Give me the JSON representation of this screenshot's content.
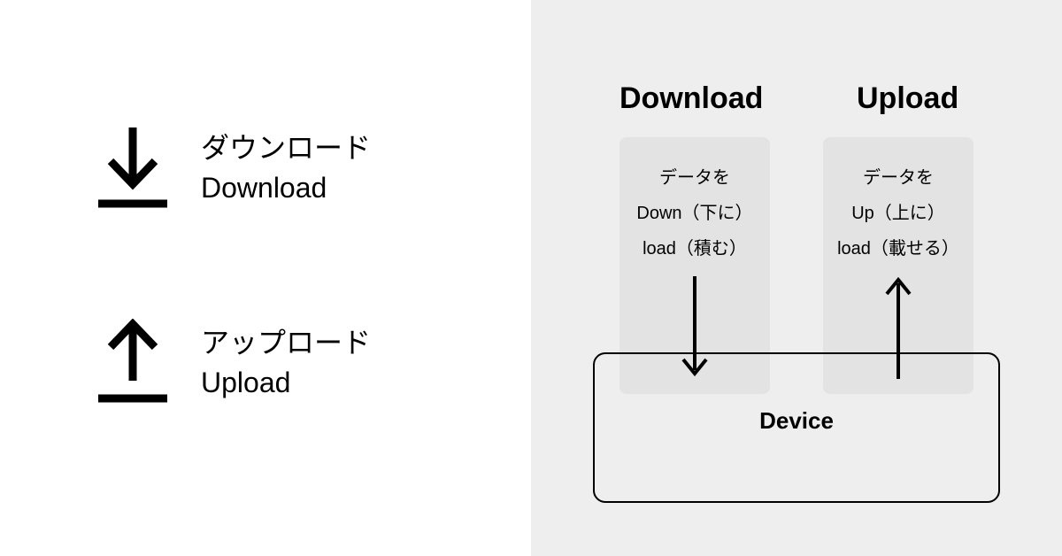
{
  "left": {
    "download": {
      "jp": "ダウンロード",
      "en": "Download"
    },
    "upload": {
      "jp": "アップロード",
      "en": "Upload"
    }
  },
  "right": {
    "download_title": "Download",
    "upload_title": "Upload",
    "download_box": {
      "l1": "データを",
      "l2": "Down（下に）",
      "l3": "load（積む）"
    },
    "upload_box": {
      "l1": "データを",
      "l2": "Up（上に）",
      "l3": "load（載せる）"
    },
    "device_label": "Device"
  }
}
